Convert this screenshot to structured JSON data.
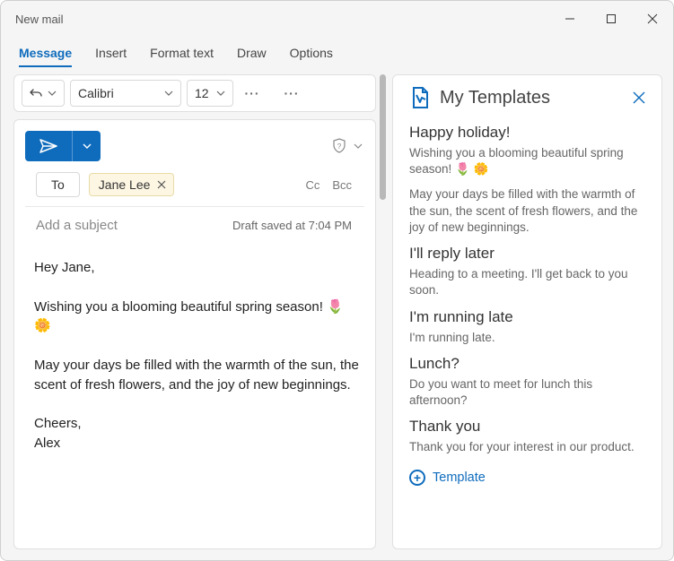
{
  "window": {
    "title": "New mail"
  },
  "tabs": [
    "Message",
    "Insert",
    "Format text",
    "Draw",
    "Options"
  ],
  "toolbar": {
    "font": "Calibri",
    "size": "12"
  },
  "compose": {
    "to_label": "To",
    "recipient": "Jane Lee",
    "cc_label": "Cc",
    "bcc_label": "Bcc",
    "subject_placeholder": "Add a subject",
    "draft_status": "Draft saved at 7:04 PM",
    "body": "Hey Jane,\n\nWishing you a blooming beautiful spring season! 🌷 🌼\n\nMay your days be filled with the warmth of the sun, the scent of fresh flowers, and the joy of new beginnings.\n\nCheers,\nAlex"
  },
  "panel": {
    "title": "My Templates",
    "templates": [
      {
        "title": "Happy holiday!",
        "preview": "Wishing you a blooming beautiful spring season! 🌷 🌼",
        "preview2": "May your days be filled with the warmth of the sun, the scent of fresh flowers, and the joy of new beginnings."
      },
      {
        "title": "I'll reply later",
        "preview": "Heading to a meeting. I'll get back to you soon."
      },
      {
        "title": "I'm running late",
        "preview": "I'm running late."
      },
      {
        "title": "Lunch?",
        "preview": "Do you want to meet for lunch this afternoon?"
      },
      {
        "title": "Thank you",
        "preview": "Thank you for your interest in our product."
      }
    ],
    "add_label": "Template"
  }
}
